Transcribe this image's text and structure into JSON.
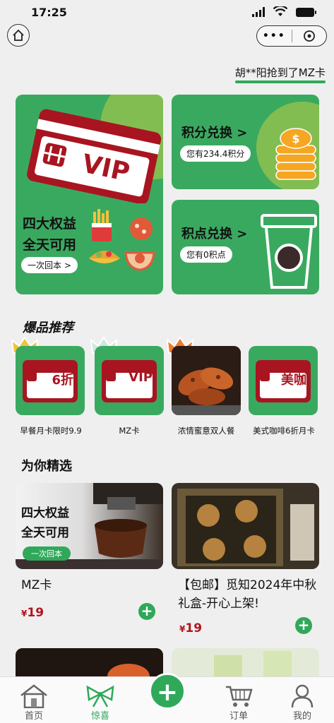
{
  "status": {
    "time": "17:25"
  },
  "marquee": {
    "text": "胡**阳抢到了MZ卡"
  },
  "cards": {
    "big": {
      "vip_text": "VIP",
      "line1": "四大权益",
      "line2": "全天可用",
      "button": "一次回本 >"
    },
    "points": {
      "title": "积分兑换 >",
      "balance": "您有234.4积分"
    },
    "dots": {
      "title": "积点兑换 >",
      "balance": "您有0积点"
    }
  },
  "hot": {
    "title": "爆品推荐",
    "items": [
      {
        "label": "早餐月卡限时9.9",
        "badge": "6折"
      },
      {
        "label": "MZ卡",
        "badge": "VIP"
      },
      {
        "label": "浓情蜜意双人餐",
        "badge": ""
      },
      {
        "label": "美式咖啡6折月卡",
        "badge": "美咖"
      }
    ]
  },
  "picks": {
    "title": "为你精选",
    "items": [
      {
        "overlay1": "四大权益",
        "overlay2": "全天可用",
        "overlay_btn": "一次回本",
        "name": "MZ卡",
        "currency": "¥",
        "price": "19"
      },
      {
        "name": "【包邮】觅知2024年中秋礼盒-开心上架!",
        "currency": "¥",
        "price": "19"
      }
    ]
  },
  "tabbar": {
    "home": "首页",
    "surprise": "惊喜",
    "add": "+",
    "orders": "订单",
    "mine": "我的"
  },
  "colors": {
    "brand_green": "#3aa960",
    "accent_green": "#2fa85a",
    "vip_red": "#a81520",
    "price_red": "#b0151e"
  }
}
